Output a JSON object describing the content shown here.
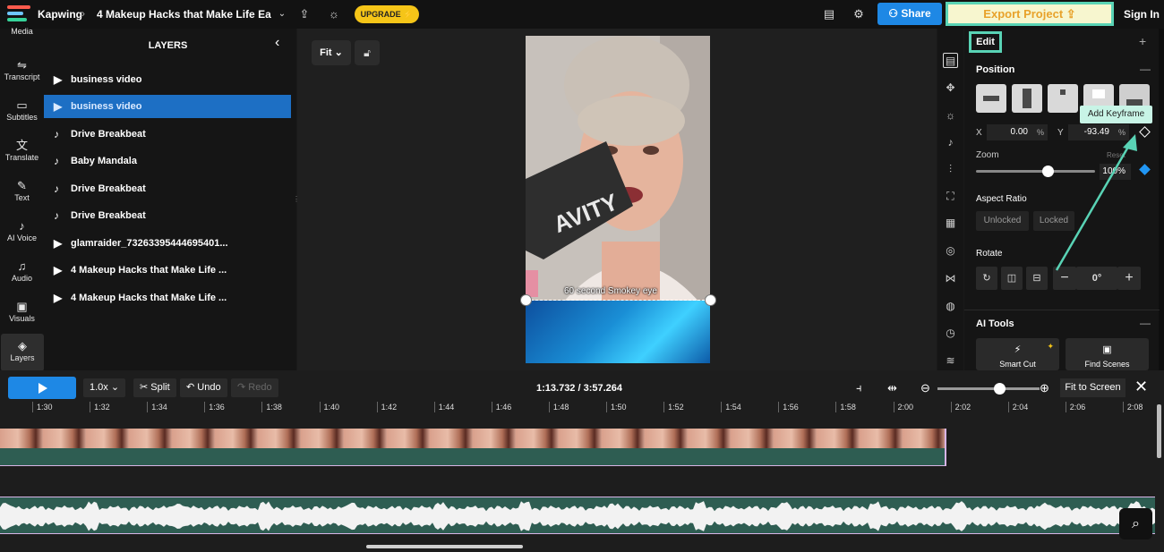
{
  "header": {
    "brand": "Kapwing",
    "project_title": "4 Makeup Hacks that Make Life Ea...",
    "upgrade_label": "UPGRADE ⚡",
    "share_label": "Share",
    "export_label": "Export Project",
    "signin_label": "Sign In"
  },
  "sidebar": {
    "items": [
      {
        "label": "Media",
        "icon": "media-icon"
      },
      {
        "label": "Transcript",
        "icon": "transcript-icon"
      },
      {
        "label": "Subtitles",
        "icon": "subtitles-icon"
      },
      {
        "label": "Translate",
        "icon": "translate-icon"
      },
      {
        "label": "Text",
        "icon": "text-icon"
      },
      {
        "label": "AI Voice",
        "icon": "ai-voice-icon"
      },
      {
        "label": "Audio",
        "icon": "audio-icon"
      },
      {
        "label": "Visuals",
        "icon": "visuals-icon"
      },
      {
        "label": "Layers",
        "icon": "layers-icon"
      }
    ]
  },
  "layers": {
    "title": "LAYERS",
    "items": [
      {
        "label": "business video",
        "type": "video"
      },
      {
        "label": "business video",
        "type": "video",
        "selected": true
      },
      {
        "label": "Drive Breakbeat",
        "type": "audio"
      },
      {
        "label": "Baby Mandala",
        "type": "audio"
      },
      {
        "label": "Drive Breakbeat",
        "type": "audio"
      },
      {
        "label": "Drive Breakbeat",
        "type": "audio"
      },
      {
        "label": "glamraider_73263395444695401...",
        "type": "video"
      },
      {
        "label": "4 Makeup Hacks that Make Life ...",
        "type": "video"
      },
      {
        "label": "4 Makeup Hacks that Make Life ...",
        "type": "video"
      }
    ]
  },
  "canvas": {
    "fit_label": "Fit",
    "caption": "60 second Smokey eye"
  },
  "edit_panel": {
    "tab_label": "Edit",
    "position_title": "Position",
    "x_label": "X",
    "x_value": "0.00",
    "y_label": "Y",
    "y_value": "-93.49",
    "percent": "%",
    "tooltip": "Add Keyframe",
    "zoom_label": "Zoom",
    "zoom_reset": "Reset",
    "zoom_value": "100%",
    "zoom_level": 0.6,
    "aspect_title": "Aspect Ratio",
    "aspect_unlocked": "Unlocked",
    "aspect_locked": "Locked",
    "rotate_title": "Rotate",
    "rotate_value": "0°",
    "ai_title": "AI Tools",
    "ai_smart_cut": "Smart Cut",
    "ai_find_scenes": "Find Scenes"
  },
  "timeline": {
    "speed": "1.0x",
    "split": "Split",
    "undo": "Undo",
    "redo": "Redo",
    "current_time": "1:13.732",
    "total_time": "3:57.264",
    "time_display": "1:13.732 / 3:57.264",
    "fit_to_screen": "Fit to Screen",
    "ruler": [
      "1:30",
      "1:32",
      "1:34",
      "1:36",
      "1:38",
      "1:40",
      "1:42",
      "1:44",
      "1:46",
      "1:48",
      "1:50",
      "1:52",
      "1:54",
      "1:56",
      "1:58",
      "2:00",
      "2:02",
      "2:04",
      "2:06",
      "2:08"
    ]
  },
  "colors": {
    "accent": "#1e88e5",
    "highlight": "#59d3b5",
    "upgrade": "#f5c518",
    "track": "#2e5d52",
    "keyframe": "#2196f3"
  }
}
